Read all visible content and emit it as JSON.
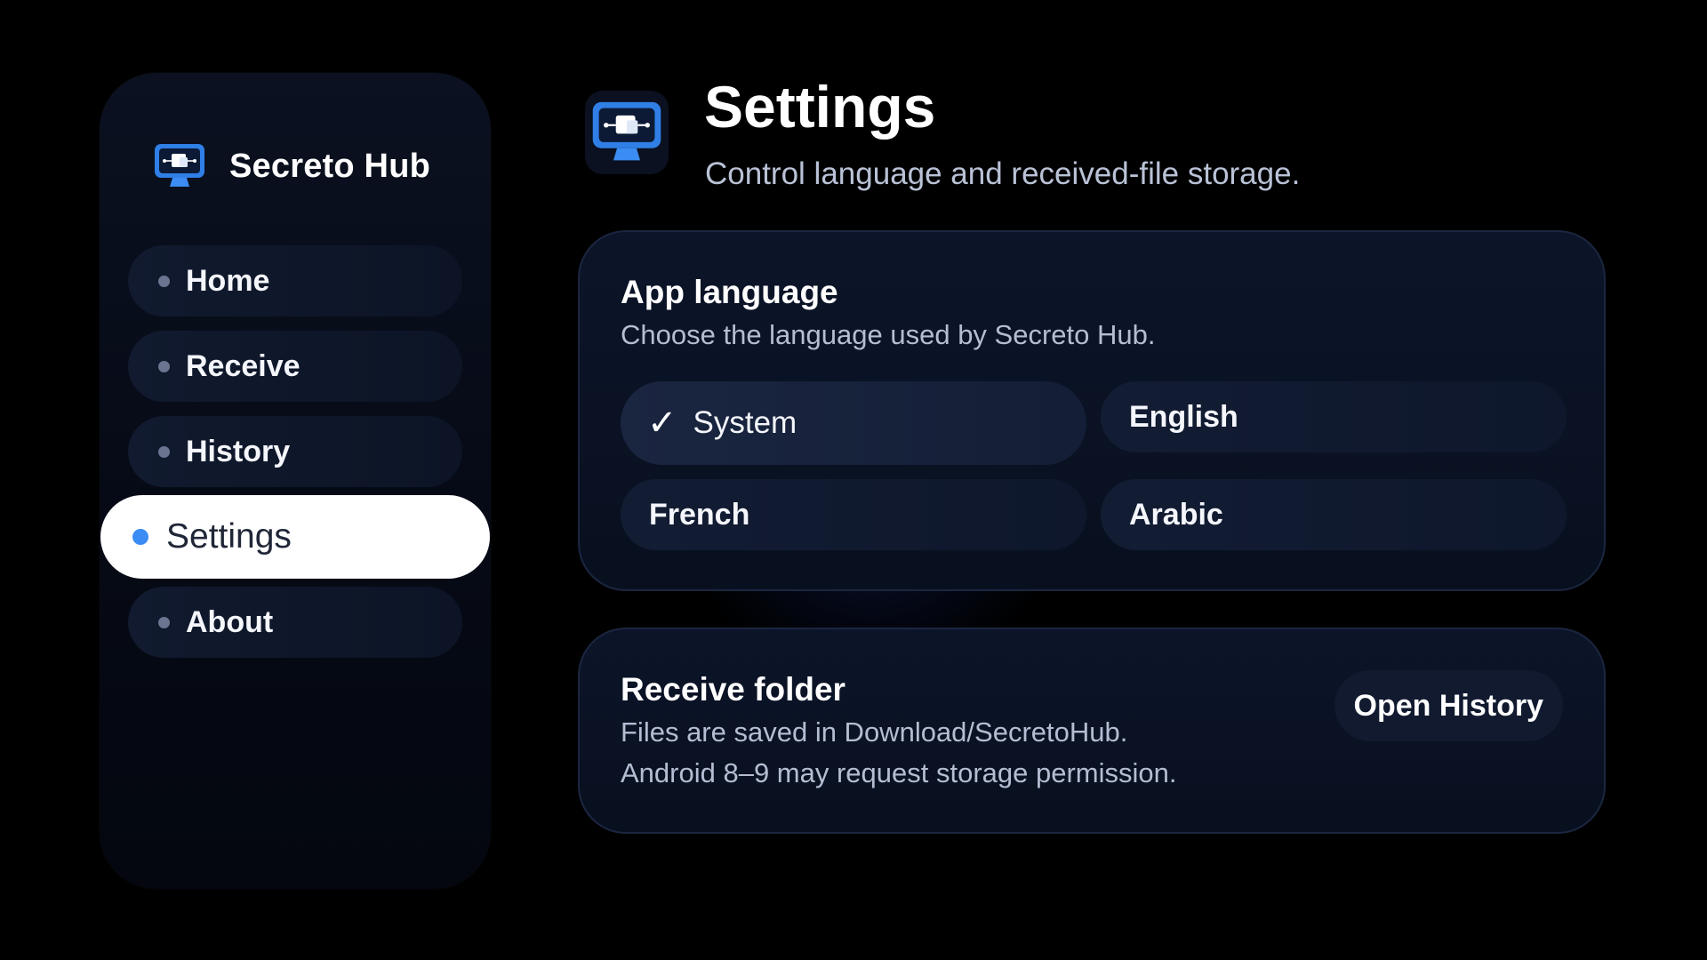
{
  "app": {
    "name": "Secreto Hub",
    "logo_icon": "monitor-icon",
    "accent_color": "#3b8cf4"
  },
  "sidebar": {
    "items": [
      {
        "label": "Home",
        "active": false
      },
      {
        "label": "Receive",
        "active": false
      },
      {
        "label": "History",
        "active": false
      },
      {
        "label": "Settings",
        "active": true
      },
      {
        "label": "About",
        "active": false
      }
    ]
  },
  "header": {
    "title": "Settings",
    "subtitle": "Control language and received-file storage."
  },
  "language": {
    "title": "App language",
    "description": "Choose the language used by Secreto Hub.",
    "selected": "System",
    "check_glyph": "✓",
    "options": [
      {
        "label": "System"
      },
      {
        "label": "English"
      },
      {
        "label": "French"
      },
      {
        "label": "Arabic"
      }
    ]
  },
  "receive_folder": {
    "title": "Receive folder",
    "line1": "Files are saved in Download/SecretoHub.",
    "line2": "Android 8–9 may request storage permission.",
    "button_label": "Open History"
  }
}
